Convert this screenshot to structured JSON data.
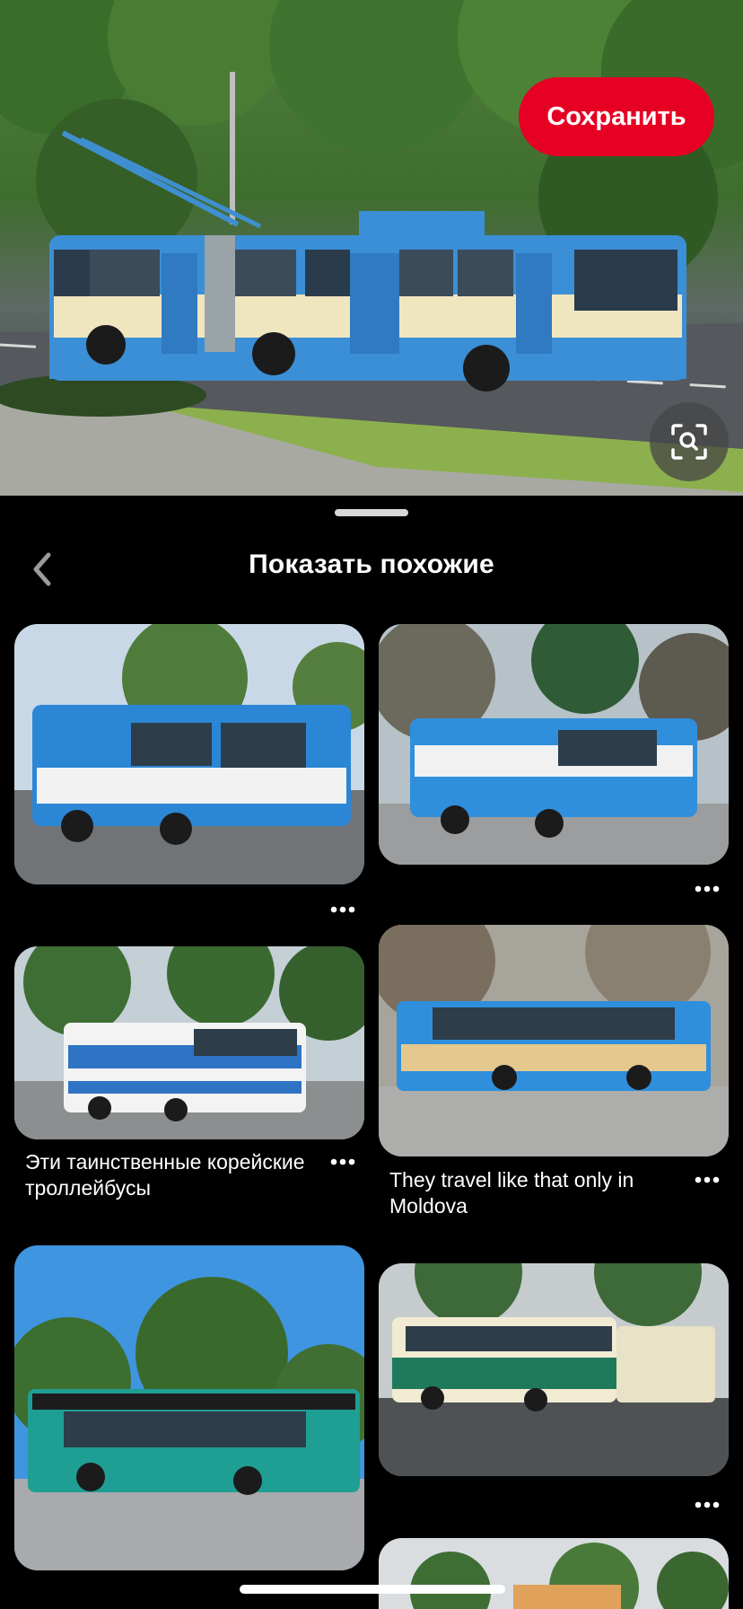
{
  "hero": {
    "save_label": "Сохранить",
    "lens_icon": "visual-search-icon"
  },
  "related": {
    "title": "Показать похожие"
  },
  "pins": [
    {
      "caption": "",
      "scheme": "blue-white"
    },
    {
      "caption": "",
      "scheme": "blue-white"
    },
    {
      "caption": "Эти таинственные корейские троллейбусы",
      "scheme": "white-blue"
    },
    {
      "caption": "They travel like that only in Moldova",
      "scheme": "blue-cream"
    },
    {
      "caption": "",
      "scheme": "teal-black"
    },
    {
      "caption": "",
      "scheme": "green-cream"
    }
  ],
  "colors": {
    "accent": "#e60023",
    "background": "#000000"
  }
}
